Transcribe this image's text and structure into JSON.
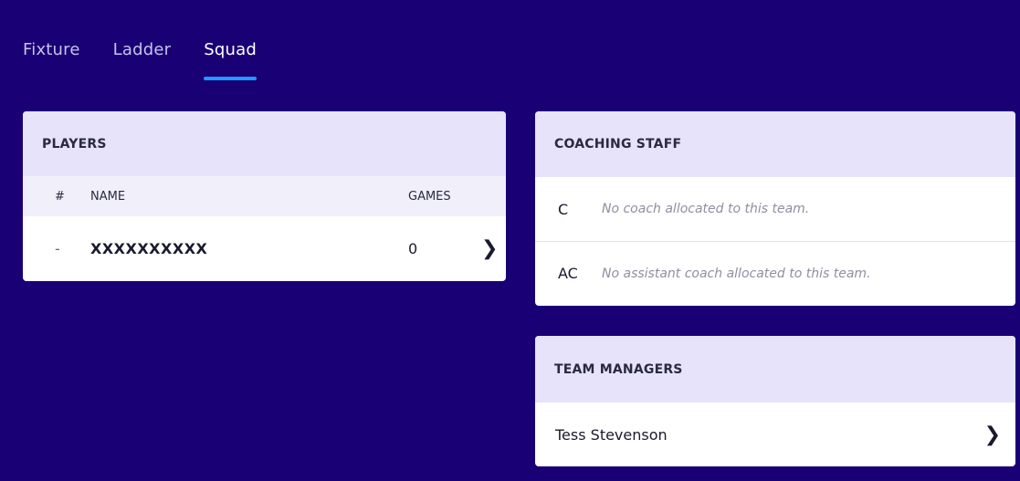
{
  "tabs": [
    {
      "label": "Fixture"
    },
    {
      "label": "Ladder"
    },
    {
      "label": "Squad",
      "active": true
    }
  ],
  "players": {
    "title": "PLAYERS",
    "columns": {
      "number": "#",
      "name": "NAME",
      "games": "GAMES"
    },
    "rows": [
      {
        "number": "-",
        "name": "XXXXXXXXXX",
        "games": "0",
        "chevron_icon": "chevron-right-icon"
      }
    ]
  },
  "coaching": {
    "title": "COACHING STAFF",
    "rows": [
      {
        "role": "C",
        "note": "No coach allocated to this team."
      },
      {
        "role": "AC",
        "note": "No assistant coach allocated to this team."
      }
    ]
  },
  "managers": {
    "title": "TEAM MANAGERS",
    "rows": [
      {
        "name": "Tess Stevenson",
        "chevron_icon": "chevron-right-icon"
      }
    ]
  },
  "colors": {
    "background": "#1a0075",
    "card_header": "#e6e3fb",
    "tab_indicator": "#1e9bff"
  }
}
